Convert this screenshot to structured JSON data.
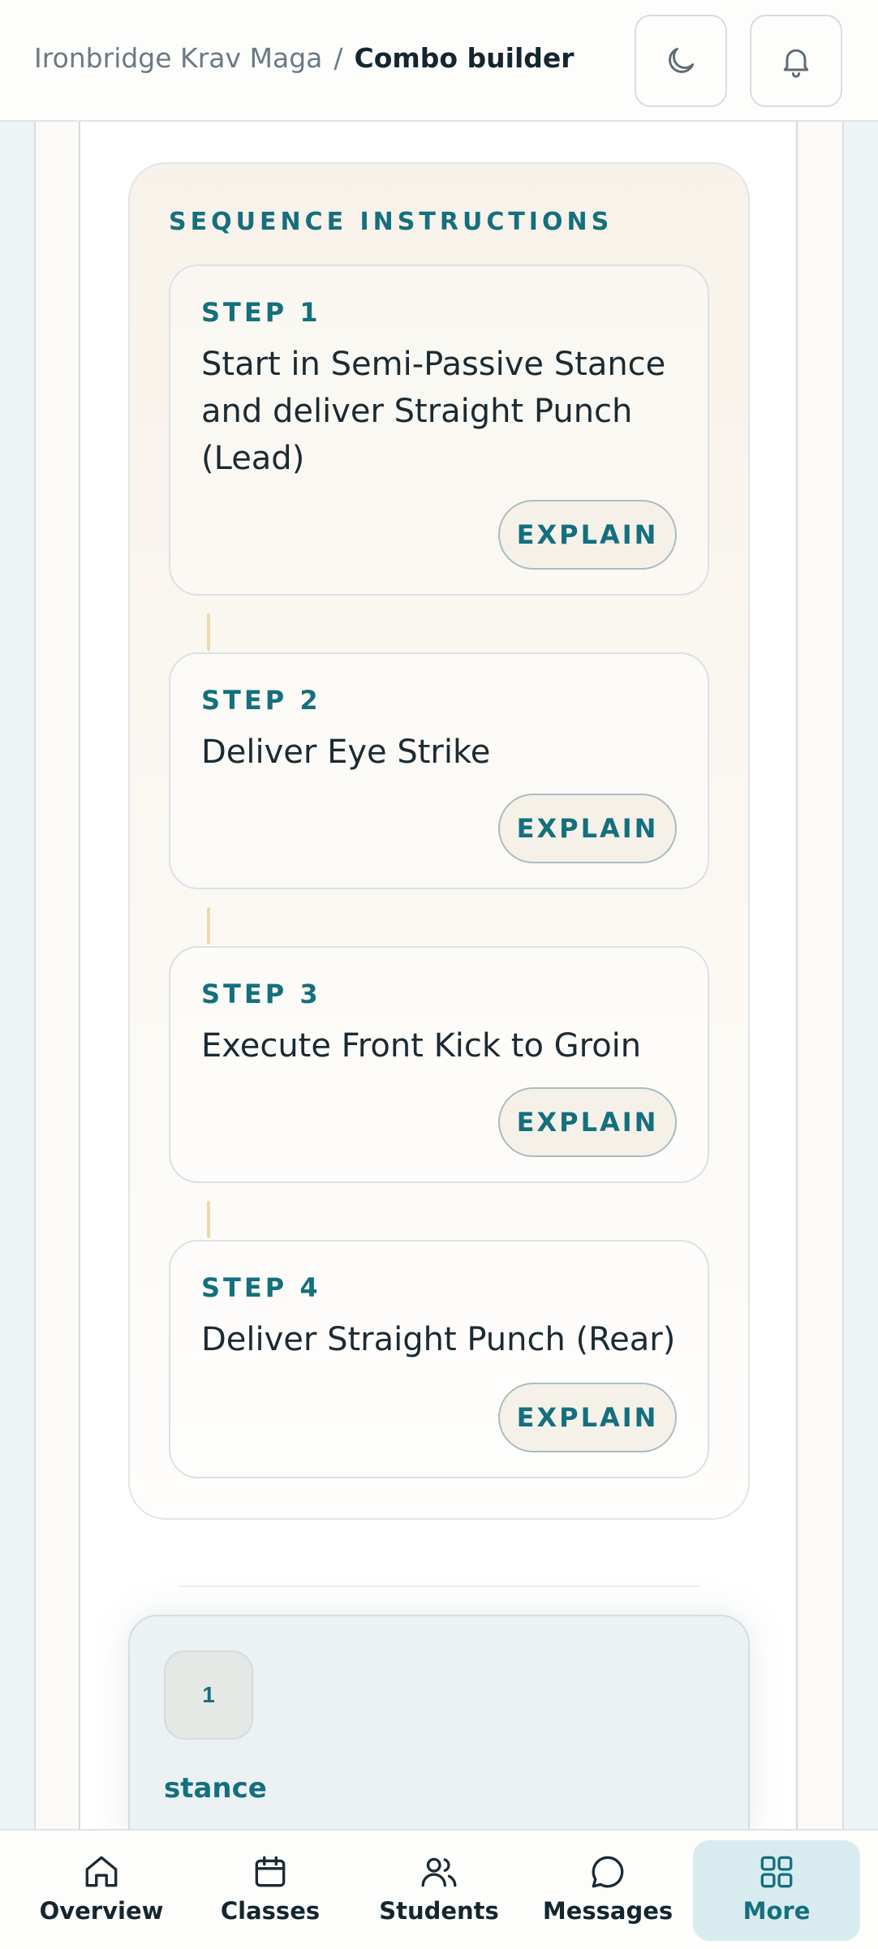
{
  "header": {
    "breadcrumb_root": "Ironbridge Krav Maga",
    "breadcrumb_separator": "/",
    "breadcrumb_current": "Combo builder",
    "theme_toggle_icon": "moon-icon",
    "notifications_icon": "bell-icon"
  },
  "sequence": {
    "title": "SEQUENCE INSTRUCTIONS",
    "explain_label": "EXPLAIN",
    "steps": [
      {
        "label": "STEP 1",
        "text": "Start in Semi-Passive Stance and deliver Straight Punch (Lead)"
      },
      {
        "label": "STEP 2",
        "text": "Deliver Eye Strike"
      },
      {
        "label": "STEP 3",
        "text": "Execute Front Kick to Groin"
      },
      {
        "label": "STEP 4",
        "text": "Deliver Straight Punch (Rear)"
      }
    ]
  },
  "technique": {
    "number": "1",
    "name": "stance"
  },
  "nav": {
    "items": [
      {
        "label": "Overview",
        "icon": "home-icon"
      },
      {
        "label": "Classes",
        "icon": "calendar-icon"
      },
      {
        "label": "Students",
        "icon": "users-icon"
      },
      {
        "label": "Messages",
        "icon": "message-icon"
      },
      {
        "label": "More",
        "icon": "grid-icon"
      }
    ],
    "active": "More"
  },
  "colors": {
    "accent": "#146f7e",
    "active_nav_bg": "#d8ecf0"
  }
}
